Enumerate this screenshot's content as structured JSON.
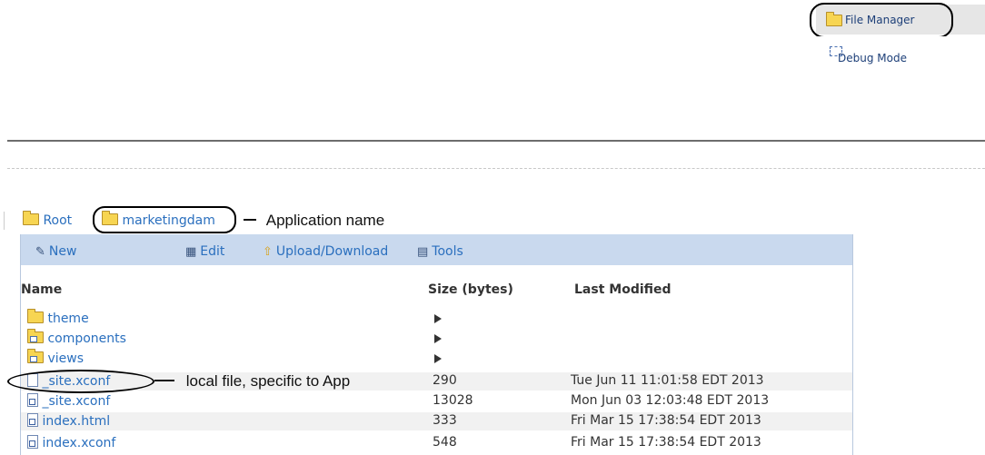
{
  "menu": {
    "items": [
      {
        "label": "File Manager"
      },
      {
        "label": "Debug Mode"
      }
    ]
  },
  "breadcrumb": {
    "root": "Root",
    "app": "marketingdam",
    "annotation": "Application name"
  },
  "toolbar": {
    "new": "New",
    "edit": "Edit",
    "upload": "Upload/Download",
    "tools": "Tools"
  },
  "table": {
    "columns": [
      "Name",
      "Size (bytes)",
      "Last Modified"
    ],
    "rows": [
      {
        "name": "theme",
        "type": "folder",
        "size": "",
        "modified": ""
      },
      {
        "name": "components",
        "type": "folder-sub",
        "size": "",
        "modified": ""
      },
      {
        "name": "views",
        "type": "folder-sub",
        "size": "",
        "modified": ""
      },
      {
        "name": "_site.xconf",
        "type": "file",
        "size": "290",
        "modified": "Tue Jun 11 11:01:58 EDT 2013"
      },
      {
        "name": "_site.xconf",
        "type": "file-active",
        "size": "13028",
        "modified": "Mon Jun 03 12:03:48 EDT 2013"
      },
      {
        "name": "index.html",
        "type": "file-active",
        "size": "333",
        "modified": "Fri Mar 15 17:38:54 EDT 2013"
      },
      {
        "name": "index.xconf",
        "type": "file-active",
        "size": "548",
        "modified": "Fri Mar 15 17:38:54 EDT 2013"
      }
    ]
  },
  "annotations": {
    "local_file": "local file, specific to App"
  }
}
